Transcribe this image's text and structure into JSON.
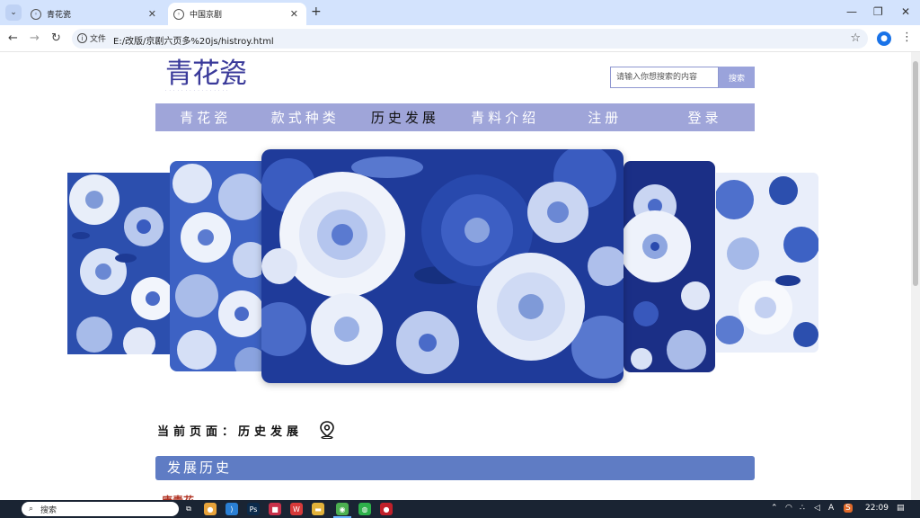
{
  "browser": {
    "tabs": [
      {
        "title": "青花瓷",
        "active": false
      },
      {
        "title": "中国京剧",
        "active": true
      }
    ],
    "address": {
      "security_label": "文件",
      "url": "E:/改版/京剧六页多%20js/histroy.html"
    }
  },
  "page": {
    "logo_text": "青花瓷",
    "search": {
      "placeholder": "请输入你想搜索的内容",
      "button_label": "搜索"
    },
    "nav": [
      {
        "label": "青花瓷",
        "active": false
      },
      {
        "label": "款式种类",
        "active": false
      },
      {
        "label": "历史发展",
        "active": true
      },
      {
        "label": "青料介绍",
        "active": false
      },
      {
        "label": "注册",
        "active": false
      },
      {
        "label": "登录",
        "active": false
      }
    ],
    "breadcrumb": "当前页面：历史发展",
    "section_title": "发展历史",
    "sub_heading": "唐青花"
  },
  "taskbar": {
    "search_label": "搜索",
    "clock": "22:09",
    "ime_label": "A"
  },
  "colors": {
    "nav_bg": "#9fa5d9",
    "section_bg": "#5f7cc4",
    "logo": "#3a3a9a",
    "accent_red": "#b03020"
  }
}
